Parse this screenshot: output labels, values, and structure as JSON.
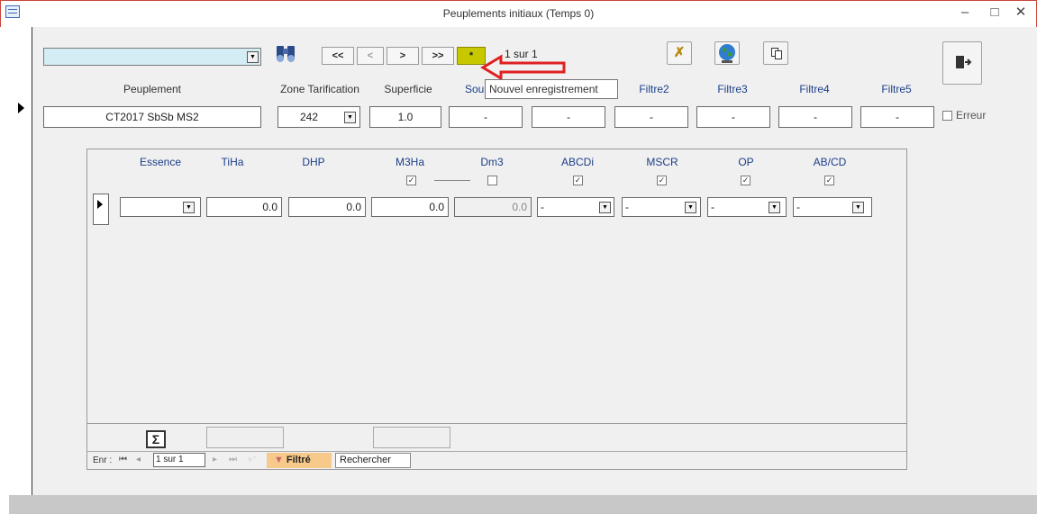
{
  "window": {
    "title": "Peuplements initiaux (Temps 0)",
    "minimize": "–",
    "maximize": "□",
    "close": "✕"
  },
  "toolbar": {
    "search_combo_value": "",
    "nav_first": "<<",
    "nav_prev": "<",
    "nav_next": ">",
    "nav_last": ">>",
    "nav_new": "*",
    "record_counter": "1 sur 1",
    "tooltip": "Nouvel enregistrement"
  },
  "header": {
    "labels": {
      "peuplement": "Peuplement",
      "zone": "Zone Tarification",
      "superficie": "Superficie",
      "sous": "Sou",
      "filtre2": "Filtre2",
      "filtre3": "Filtre3",
      "filtre4": "Filtre4",
      "filtre5": "Filtre5"
    },
    "values": {
      "peuplement": "CT2017 SbSb MS2",
      "zone": "242",
      "superficie": "1.0",
      "sous": "-",
      "filtre1": "-",
      "filtre2": "-",
      "filtre3": "-",
      "filtre4": "-",
      "filtre5": "-"
    },
    "erreur_label": "Erreur"
  },
  "subform": {
    "columns": [
      "Essence",
      "TiHa",
      "DHP",
      "M3Ha",
      "Dm3",
      "ABCDi",
      "MSCR",
      "OP",
      "AB/CD"
    ],
    "checks": {
      "m3ha": "✓",
      "dm3": "",
      "abcdi": "✓",
      "mscr": "✓",
      "op": "✓",
      "abcd": "✓"
    },
    "row": {
      "essence": "",
      "tiha": "0.0",
      "dhp": "0.0",
      "m3ha": "0.0",
      "dm3": "0.0",
      "abcdi": "-",
      "mscr": "-",
      "op": "-",
      "abcd": "-"
    },
    "sum_label": "Σ"
  },
  "navbar": {
    "enr_label": "Enr :",
    "position": "1 sur 1",
    "filtered": "Filtré",
    "search": "Rechercher"
  },
  "colors": {
    "accent_new_button": "#c8c800",
    "arrow_annotation": "#e02020",
    "combo_fill": "#d4ecf4"
  }
}
